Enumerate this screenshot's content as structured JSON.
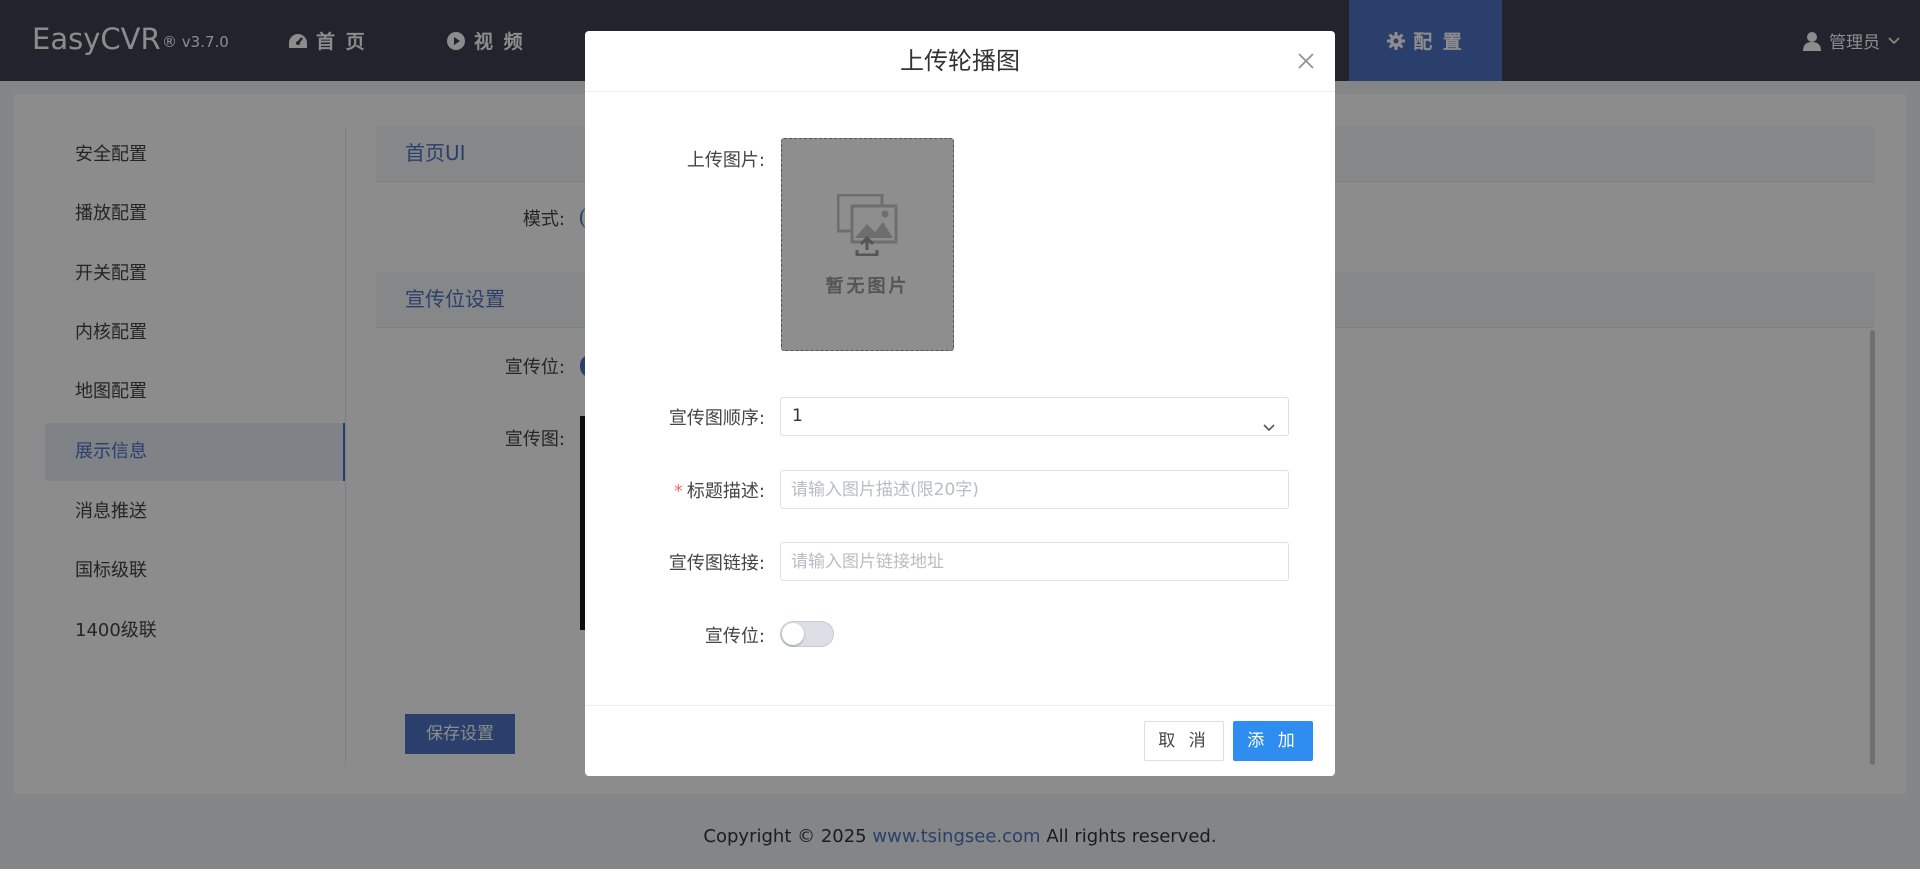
{
  "header": {
    "brand": "EasyCVR",
    "version": "® v3.7.0",
    "nav": [
      {
        "label": "首 页",
        "icon": "dashboard-icon"
      },
      {
        "label": "视 频",
        "icon": "play-circle-icon"
      },
      {
        "label": "配 置",
        "icon": "gear-icon",
        "active": true
      }
    ],
    "user": {
      "name": "管理员",
      "icon": "user-icon"
    }
  },
  "sidebar": {
    "items": [
      {
        "label": "安全配置"
      },
      {
        "label": "播放配置"
      },
      {
        "label": "开关配置"
      },
      {
        "label": "内核配置"
      },
      {
        "label": "地图配置"
      },
      {
        "label": "展示信息",
        "active": true
      },
      {
        "label": "消息推送"
      },
      {
        "label": "国标级联"
      },
      {
        "label": "1400级联"
      }
    ]
  },
  "content": {
    "section1_title": "首页UI",
    "mode_label": "模式:",
    "section2_title": "宣传位设置",
    "ad_label": "宣传位:",
    "ad_image_label": "宣传图:",
    "save_label": "保存设置"
  },
  "footer": {
    "prefix": "Copyright © 2025",
    "link": "www.tsingsee.com",
    "suffix": "All rights reserved."
  },
  "modal": {
    "title": "上传轮播图",
    "upload_label": "上传图片:",
    "upload_placeholder": "暂无图片",
    "order_label": "宣传图顺序:",
    "order_value": "1",
    "title_desc_label": "标题描述:",
    "title_desc_required": "*",
    "title_desc_placeholder": "请输入图片描述(限20字)",
    "link_label": "宣传图链接:",
    "link_placeholder": "请输入图片链接地址",
    "ad_toggle_label": "宣传位:",
    "ad_toggle_on": false,
    "cancel_label": "取 消",
    "add_label": "添 加"
  },
  "colors": {
    "topbar": "#3d4352",
    "accent": "#4e73c4",
    "primary_button": "#2f8cf0",
    "required": "#f56c6c"
  }
}
